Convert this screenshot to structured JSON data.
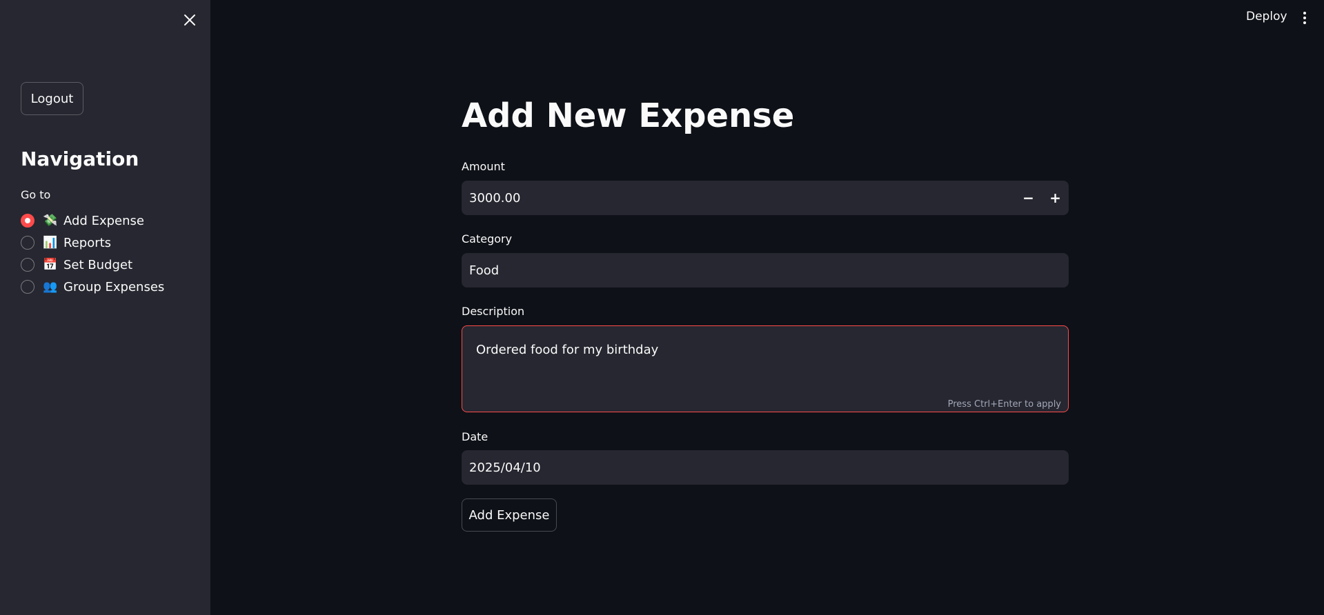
{
  "header": {
    "deploy_label": "Deploy"
  },
  "sidebar": {
    "logout_label": "Logout",
    "nav_title": "Navigation",
    "goto_label": "Go to",
    "items": [
      {
        "emoji": "💸",
        "label": "Add Expense",
        "selected": true
      },
      {
        "emoji": "📊",
        "label": "Reports",
        "selected": false
      },
      {
        "emoji": "📅",
        "label": "Set Budget",
        "selected": false
      },
      {
        "emoji": "👥",
        "label": "Group Expenses",
        "selected": false
      }
    ]
  },
  "main": {
    "title": "Add New Expense",
    "amount": {
      "label": "Amount",
      "value": "3000.00",
      "minus": "−",
      "plus": "+"
    },
    "category": {
      "label": "Category",
      "value": "Food"
    },
    "description": {
      "label": "Description",
      "value": "Ordered food for my birthday",
      "hint": "Press Ctrl+Enter to apply"
    },
    "date": {
      "label": "Date",
      "value": "2025/04/10"
    },
    "submit_label": "Add Expense"
  },
  "colors": {
    "accent": "#ff4b4b",
    "background": "#0e1117",
    "sidebar": "#262730"
  }
}
